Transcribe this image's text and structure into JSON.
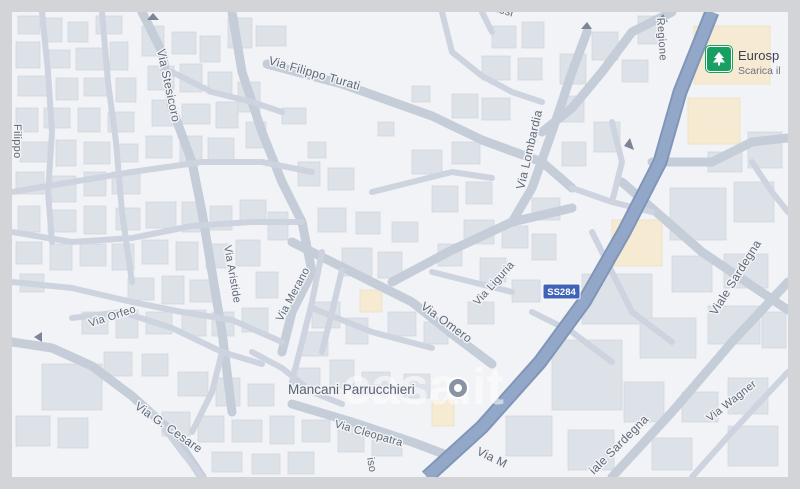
{
  "map": {
    "streets": {
      "via_stesicoro": "Via Stesicoro",
      "via_filippo_turati": "Via Filippo Turati",
      "via_lombardia": "Via Lombardia",
      "regione": "Regione",
      "via_orfeo": "Via Orfeo",
      "via_aristide": "Via Aristide",
      "via_merano": "Via Merano",
      "via_liguria": "Via Liguria",
      "via_omero": "Via Omero",
      "viale_sardegna": "Viale Sardegna",
      "viale_sardegna_2": "iale Sardegna",
      "via_wagner": "Via Wagner",
      "via_g_cesare": "Via G. Cesare",
      "via_cleopatra": "Via Cleopatra",
      "via_m": "Via M",
      "filippo_partial": "Filippo",
      "top_partial": "issi",
      "iso_partial": "iso"
    },
    "road_shield": "SS284",
    "poi": {
      "name": "Mancani Parrucchieri",
      "icon": "pin-icon"
    },
    "shop": {
      "name": "Eurosp",
      "subtitle": "Scarica il",
      "icon": "tree-icon",
      "color": "#18a063"
    },
    "watermark": "casa.it",
    "colors": {
      "background": "#f2f3f6",
      "main_road": "#8da3c2",
      "shield": "#3f63b6"
    }
  }
}
